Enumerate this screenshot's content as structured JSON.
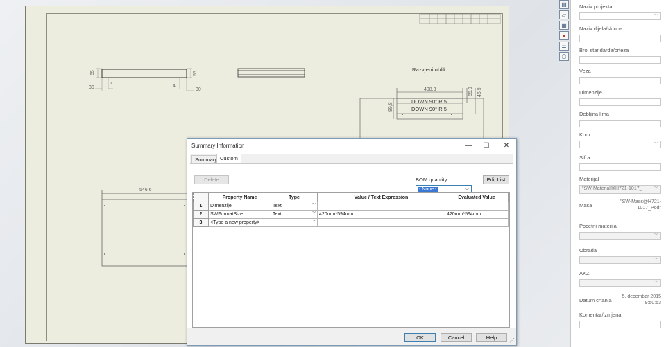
{
  "drawing": {
    "dims": {
      "d55a": "55",
      "d4a": "4",
      "d30a": "30",
      "d4b": "4",
      "d55b": "55",
      "d30b": "30",
      "d4083": "408,3",
      "d559": "55,9",
      "d469": "46,9",
      "d898": "89,8",
      "d5466": "546,6"
    },
    "flat_label": "Razvjeni oblik",
    "bend_note_1": "DOWN  90°  R 5",
    "bend_note_2": "DOWN  90°  R 5"
  },
  "dialog": {
    "title": "Summary Information",
    "minimize": "—",
    "maximize": "☐",
    "close": "✕",
    "tabs": [
      "Summary",
      "Custom"
    ],
    "delete_label": "Delete",
    "bom_label": "BOM quantity:",
    "bom_value": "- None -",
    "edit_list_label": "Edit List",
    "columns": [
      "Property Name",
      "Type",
      "Value / Text Expression",
      "Evaluated Value"
    ],
    "rows": [
      {
        "num": "1",
        "name": "Dimenzije",
        "type": "Text",
        "value": "",
        "evaluated": ""
      },
      {
        "num": "2",
        "name": "SWFormatSize",
        "type": "Text",
        "value": "420mm*594mm",
        "evaluated": "420mm*594mm"
      },
      {
        "num": "3",
        "name": "<Type a new property>",
        "type": "",
        "value": "",
        "evaluated": ""
      }
    ],
    "ok_label": "OK",
    "cancel_label": "Cancel",
    "help_label": "Help"
  },
  "panel": {
    "naziv_projekta": "Naziv projekta",
    "naziv_dijela": "Naziv dijela/sklopa",
    "broj_standarda": "Broj standarda/crteza",
    "veza": "Veza",
    "dimenzije": "Dimenzije",
    "debljina_lima": "Debljina lima",
    "kom": "Kom",
    "sifra": "Sifra",
    "materijal": "Materijal",
    "materijal_value": "\"SW-Material@H721-1017_",
    "masa": "Masa",
    "masa_value": "\"SW-Mass@H721-1017_Pod\"",
    "pocetni_materijal": "Pocetni materijal",
    "obrada": "Obrada",
    "akz": "AKZ",
    "datum_crtanja": "Datum crtanja",
    "datum_value": "5. decembar 2015 9:50:53",
    "komentar": "Komentar/izmjena"
  },
  "icons": [
    "properties-icon",
    "folder-icon",
    "image-icon",
    "color-wheel-icon",
    "list-icon",
    "printer-icon"
  ]
}
